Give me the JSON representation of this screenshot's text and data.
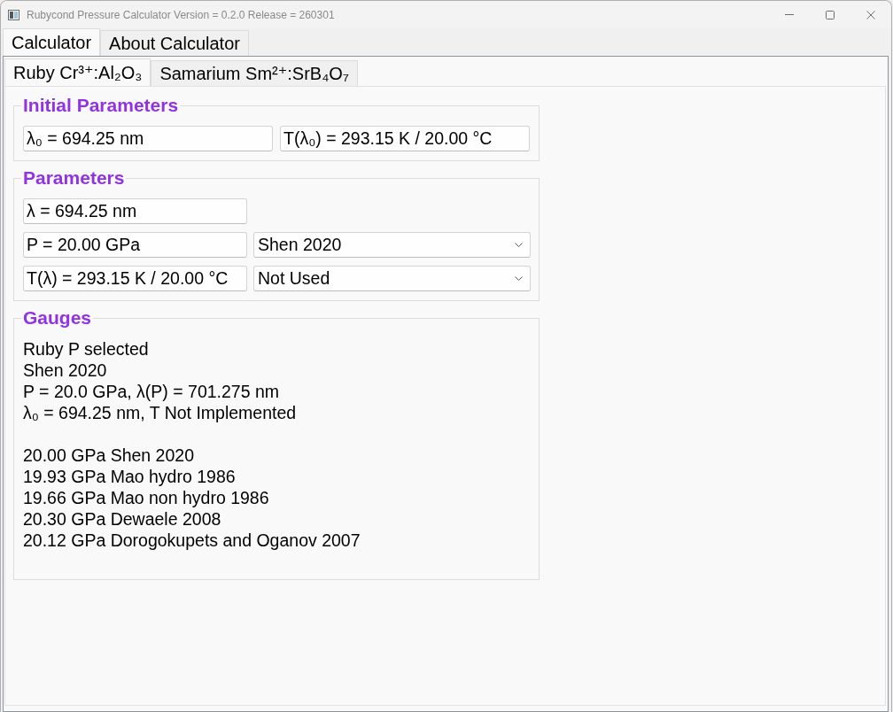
{
  "window": {
    "title": "Rubycond Pressure Calculator Version = 0.2.0 Release = 260301"
  },
  "tabs": [
    {
      "label": "Calculator",
      "selected": true
    },
    {
      "label": "About Calculator",
      "selected": false
    }
  ],
  "subtabs": [
    {
      "label": "Ruby Cr³⁺:Al₂O₃",
      "selected": true
    },
    {
      "label": "Samarium Sm²⁺:SrB₄O₇",
      "selected": false
    }
  ],
  "initial_parameters": {
    "title": "Initial Parameters",
    "fields": [
      {
        "value": "λ₀ = 694.25 nm"
      },
      {
        "value": "T(λ₀) = 293.15 K / 20.00 °C"
      }
    ]
  },
  "parameters": {
    "title": "Parameters",
    "rows": [
      {
        "field": "λ = 694.25 nm"
      },
      {
        "field": "P = 20.00 GPa",
        "dropdown": "Shen 2020"
      },
      {
        "field": "T(λ) = 293.15 K / 20.00 °C",
        "dropdown": "Not Used"
      }
    ]
  },
  "gauges": {
    "title": "Gauges",
    "summary": [
      "Ruby P selected",
      "Shen 2020",
      "P = 20.0 GPa, λ(P) = 701.275 nm",
      "λ₀ = 694.25 nm, T Not Implemented"
    ],
    "results": [
      "20.00 GPa Shen 2020",
      "19.93 GPa Mao hydro 1986",
      "19.66 GPa Mao non hydro 1986",
      "20.30 GPa Dewaele 2008",
      "20.12 GPa Dorogokupets and Oganov 2007"
    ]
  }
}
